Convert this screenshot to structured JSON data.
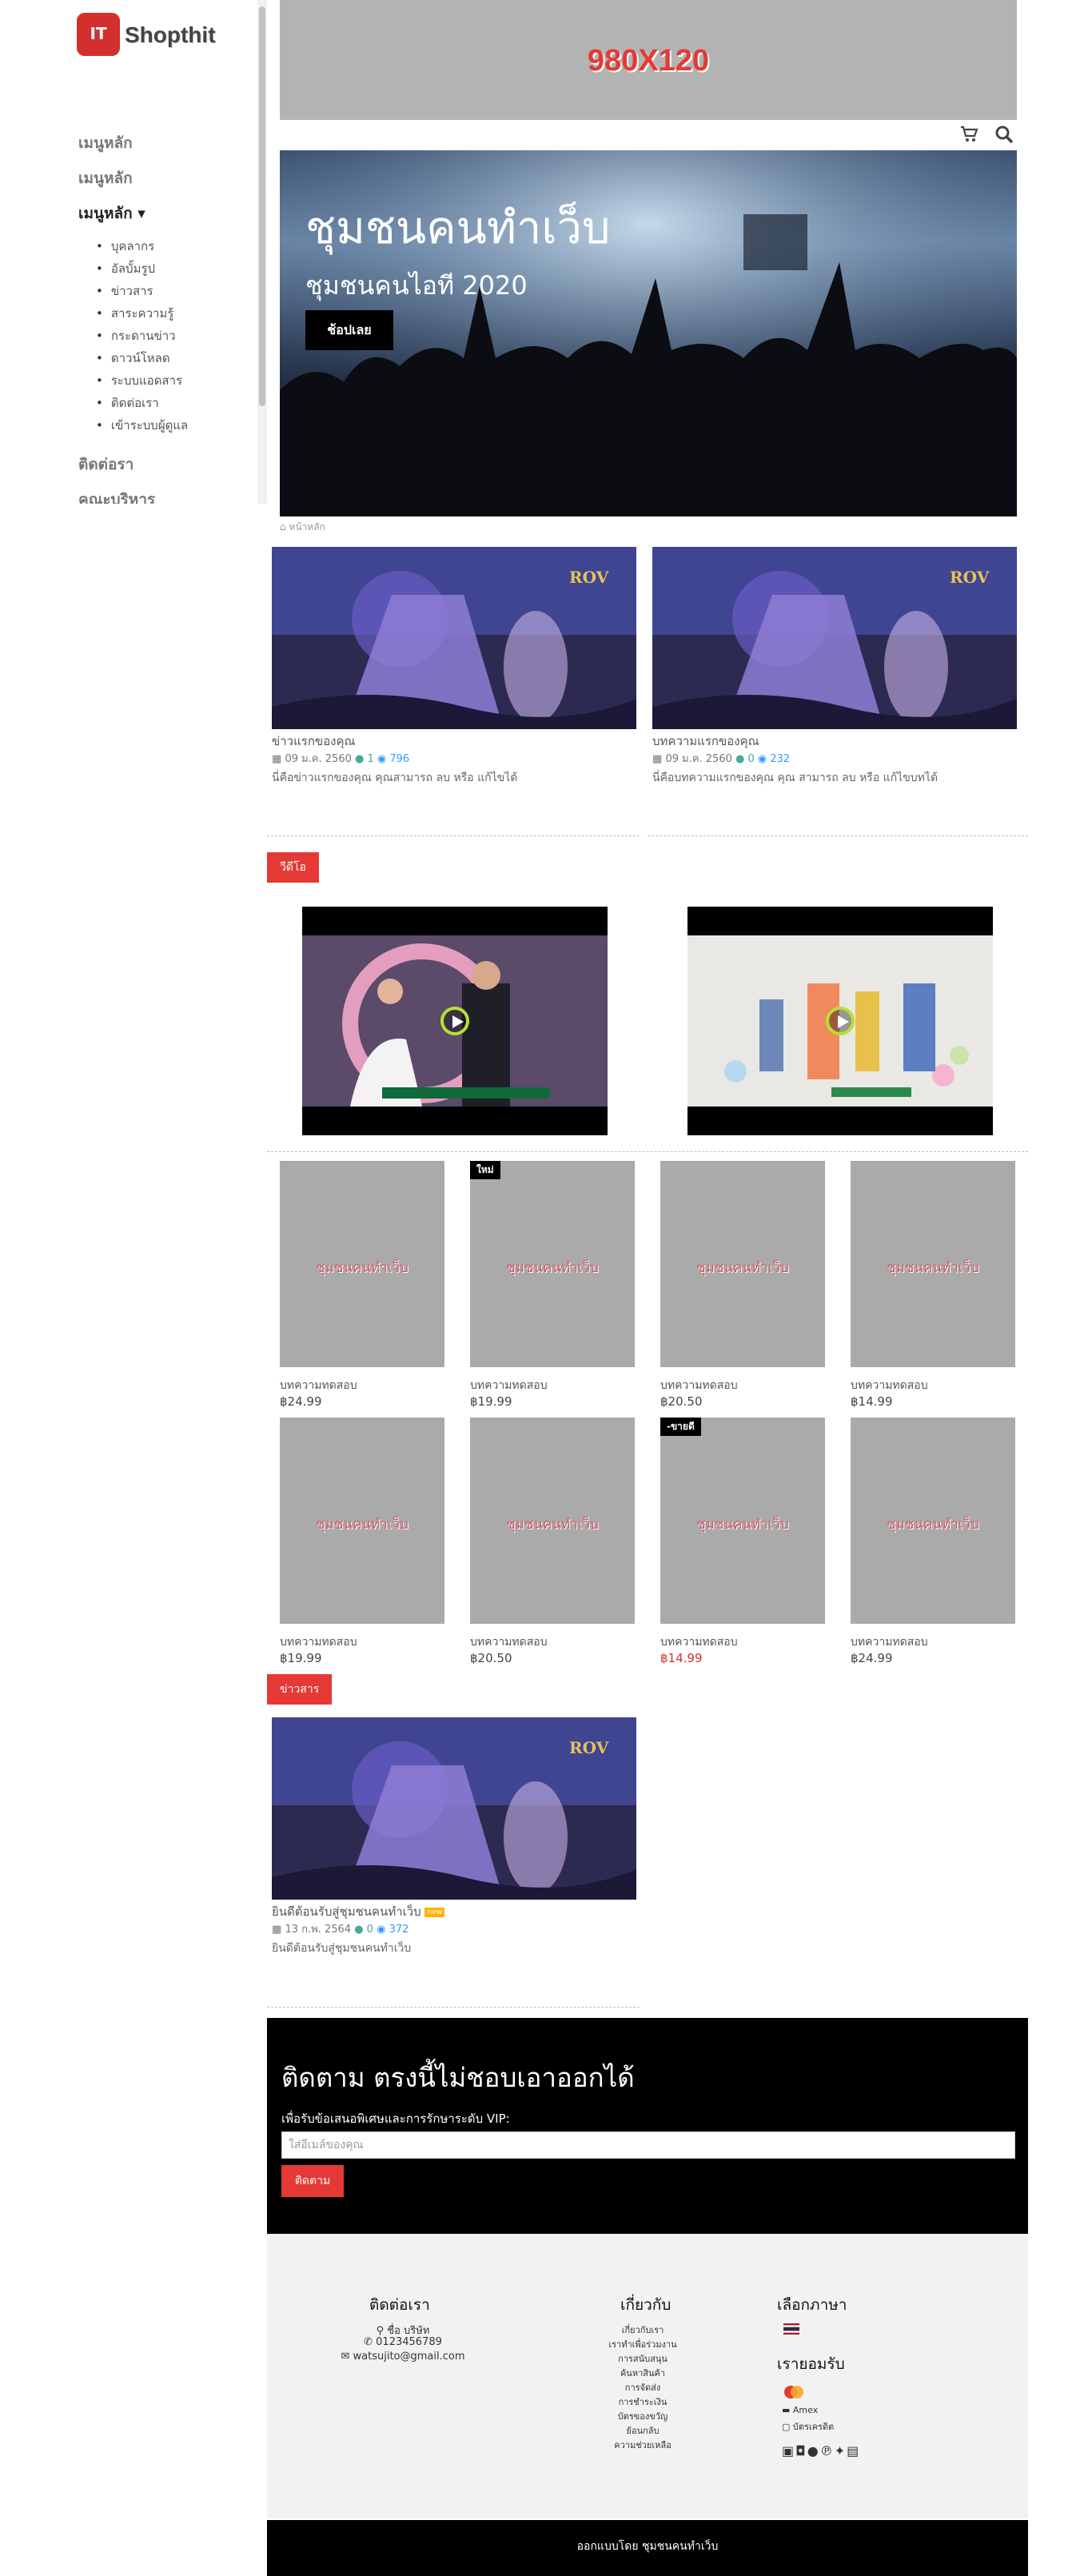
{
  "brand": {
    "logo_badge": "IT",
    "logo_text": "Shopthit"
  },
  "sidebar": {
    "menu": [
      "เมนูหลัก",
      "เมนูหลัก",
      "เมนูหลัก ▾"
    ],
    "submenu": [
      "บุคลากร",
      "อัลบั้มรูป",
      "ข่าวสาร",
      "สาระความรู้",
      "กระดานข่าว",
      "ดาวน์โหลด",
      "ระบบแอดสาร",
      "ติดต่อเรา",
      "เข้าระบบผู้ดูแล"
    ],
    "bottom_menu": [
      "ติดต่อรา",
      "คณะบริหาร"
    ]
  },
  "banner": {
    "text": "980X120"
  },
  "hero": {
    "title": "ชุมชนคนทำเว็บ",
    "subtitle": "ชุมชนคนไอที 2020",
    "button": "ช้อปเลย"
  },
  "breadcrumb": {
    "home": "หน้าหลัก"
  },
  "articles": [
    {
      "title": "ข่าวแรกของคุณ",
      "date": "09 ม.ค. 2560",
      "comments": "1",
      "views": "796",
      "desc": "นี่คือข่าวแรกของคุณ คุณสามารถ ลบ หรือ แก้ไขได้"
    },
    {
      "title": "บทความแรกของคุณ",
      "date": "09 ม.ค. 2560",
      "comments": "0",
      "views": "232",
      "desc": "นี่คือบทความแรกของคุณ คุณ สามารถ ลบ หรือ แก้ไขบทได้"
    }
  ],
  "thumb_logo": "ROV",
  "video_section": {
    "label": "วีดีโอ"
  },
  "products": [
    {
      "name": "บทความทดสอบ",
      "price": "฿24.99",
      "badge": "",
      "sale": false
    },
    {
      "name": "บทความทดสอบ",
      "price": "฿19.99",
      "badge": "ใหม่",
      "sale": false
    },
    {
      "name": "บทความทดสอบ",
      "price": "฿20.50",
      "badge": "",
      "sale": false
    },
    {
      "name": "บทความทดสอบ",
      "price": "฿14.99",
      "badge": "",
      "sale": false
    },
    {
      "name": "บทความทดสอบ",
      "price": "฿19.99",
      "badge": "",
      "sale": false
    },
    {
      "name": "บทความทดสอบ",
      "price": "฿20.50",
      "badge": "",
      "sale": false
    },
    {
      "name": "บทความทดสอบ",
      "price": "฿14.99",
      "badge": "-ขายดี",
      "sale": true
    },
    {
      "name": "บทความทดสอบ",
      "price": "฿24.99",
      "badge": "",
      "sale": false
    }
  ],
  "product_watermark": "ชุมชนคนทำเว็บ",
  "news_section": {
    "label": "ข่าวสาร",
    "item": {
      "title": "ยินดีต้อนรับสู่ชุมชนคนทำเว็บ",
      "badge": "new",
      "date": "13 ก.พ. 2564",
      "comments": "0",
      "views": "372",
      "desc": "ยินดีต้อนรับสู่ชุมชนคนทำเว็บ"
    }
  },
  "subscribe": {
    "title": "ติดตาม ตรงนี้ไม่ชอบเอาออกได้",
    "text": "เพื่อรับข้อเสนอพิเศษและการรักษาระดับ VIP:",
    "placeholder": "ใส่อีเมล์ของคุณ",
    "button": "ติดตาม"
  },
  "footer": {
    "contact": {
      "title": "ติดต่อเรา",
      "name": "ชื่อ บริษัท",
      "phone": "0123456789",
      "email": "watsujito@gmail.com"
    },
    "about": {
      "title": "เกี่ยวกับ",
      "links": [
        "เกี่ยวกับเรา",
        "เราทำเพื่อร่วมงาน",
        "การสนับสนุน",
        "ค้นหาสินค้า",
        "การจัดส่ง",
        "การชำระเงิน",
        "บัตรของขวัญ",
        "ย้อนกลับ",
        "ความช่วยเหลือ"
      ]
    },
    "language": {
      "title": "เลือกภาษา"
    },
    "accept": {
      "title": "เรายอมรับ",
      "amex": "Amex",
      "other": "บัตรเครดิต"
    },
    "social_icons": [
      "facebook-icon",
      "instagram-icon",
      "reddit-icon",
      "pinterest-icon",
      "twitter-icon",
      "linkedin-icon"
    ]
  },
  "bottom_bar": {
    "text": "ออกแบบโดย ชุมชนคนทำเว็บ"
  },
  "colors": {
    "accent": "#e53935",
    "banner_bg": "#b3b3b3",
    "product_bg": "#aaaaaa"
  }
}
